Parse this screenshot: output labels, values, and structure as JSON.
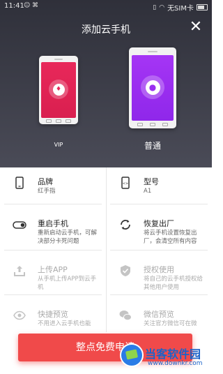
{
  "status_bar": {
    "time": "11:41",
    "carrier": "无SIM卡"
  },
  "header": {
    "title": "添加云手机"
  },
  "phones": [
    {
      "label": "VIP",
      "color": "#e8285a"
    },
    {
      "label": "普通",
      "color": "#9a2ef0"
    }
  ],
  "cells": {
    "brand": {
      "title": "品牌",
      "desc": "红手指"
    },
    "model": {
      "title": "型号",
      "desc": "A1"
    },
    "restart": {
      "title": "重启手机",
      "desc": "重新启动云手机，可解决部分卡死问题"
    },
    "factory": {
      "title": "恢复出厂",
      "desc": "将云手机设置恢复出厂，会清空所有内容"
    },
    "upload": {
      "title": "上传APP",
      "desc": "从手机上传APP到云手机"
    },
    "authorize": {
      "title": "授权使用",
      "desc": "将自己的云手机授权给其他用户使用"
    },
    "quick_preview": {
      "title": "快捷预览",
      "desc": "不用进入云手机也能"
    },
    "wechat_preview": {
      "title": "微信预览",
      "desc": "关注官方微信可在微"
    }
  },
  "cta": {
    "label": "整点免费申请"
  },
  "watermark": {
    "name": "当客软件园",
    "url": "www.downkr.com"
  }
}
